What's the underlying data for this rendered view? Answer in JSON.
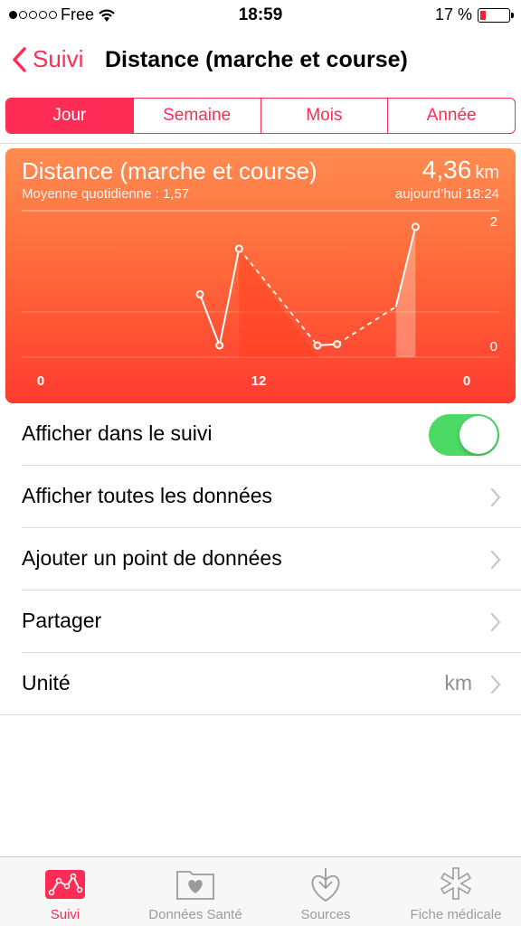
{
  "status": {
    "carrier": "Free",
    "time": "18:59",
    "battery": "17 %"
  },
  "nav": {
    "back_label": "Suivi",
    "title": "Distance (marche et course)"
  },
  "segments": [
    "Jour",
    "Semaine",
    "Mois",
    "Année"
  ],
  "card": {
    "title": "Distance (marche et course)",
    "subtitle": "Moyenne quotidienne : 1,57",
    "value": "4,36",
    "unit": "km",
    "timestamp": "aujourd’hui 18:24"
  },
  "chart_data": {
    "type": "line",
    "x": [
      9,
      10,
      11,
      15,
      16,
      19,
      20
    ],
    "y": [
      0.82,
      0.0,
      1.55,
      0.0,
      0.02,
      0.62,
      1.9
    ],
    "xlim": [
      0,
      24
    ],
    "ylim": [
      0,
      2
    ],
    "x_tick_labels": [
      "0",
      "12",
      "0"
    ],
    "y_tick_labels": [
      "2",
      "0"
    ],
    "grid": true
  },
  "rows": [
    {
      "label": "Afficher dans le suivi"
    },
    {
      "label": "Afficher toutes les données"
    },
    {
      "label": "Ajouter un point de données"
    },
    {
      "label": "Partager"
    },
    {
      "label": "Unité",
      "detail": "km"
    }
  ],
  "tabs": [
    {
      "label": "Suivi",
      "icon": "chart-icon"
    },
    {
      "label": "Données Santé",
      "icon": "heart-folder-icon"
    },
    {
      "label": "Sources",
      "icon": "download-heart-icon"
    },
    {
      "label": "Fiche médicale",
      "icon": "medical-star-icon"
    }
  ],
  "colors": {
    "accent": "#ff2d55",
    "toggle_on": "#4cd964"
  }
}
